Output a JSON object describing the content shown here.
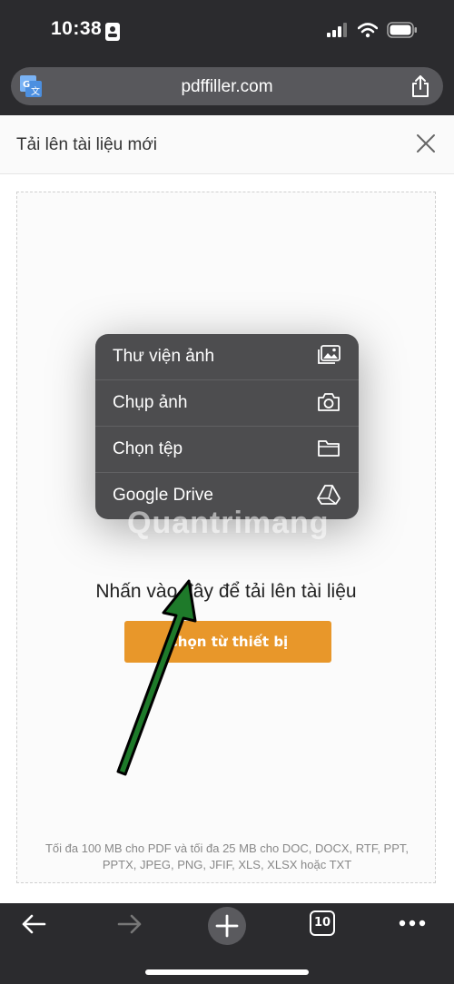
{
  "status": {
    "time": "10:38"
  },
  "browser": {
    "url": "pdffiller.com"
  },
  "sheet": {
    "title": "Tải lên tài liệu mới",
    "drop_text": "Nhấn vào đây để tải lên tài liệu",
    "choose_button": "Chọn từ thiết bị",
    "limits_text": "Tối đa 100 MB cho PDF và tối đa 25 MB cho DOC, DOCX, RTF, PPT, PPTX, JPEG, PNG, JFIF, XLS, XLSX hoặc TXT"
  },
  "menu": {
    "items": [
      {
        "label": "Thư viện ảnh",
        "icon": "photo-library-icon"
      },
      {
        "label": "Chụp ảnh",
        "icon": "camera-icon"
      },
      {
        "label": "Chọn tệp",
        "icon": "folder-icon"
      },
      {
        "label": "Google Drive",
        "icon": "google-drive-icon"
      }
    ]
  },
  "watermark": {
    "text": "Quantrimang"
  },
  "toolbar": {
    "tabs_count": "10"
  },
  "colors": {
    "accent": "#e8972a",
    "menu_bg": "#4d4d4f",
    "arrow": "#1e7a2a"
  }
}
